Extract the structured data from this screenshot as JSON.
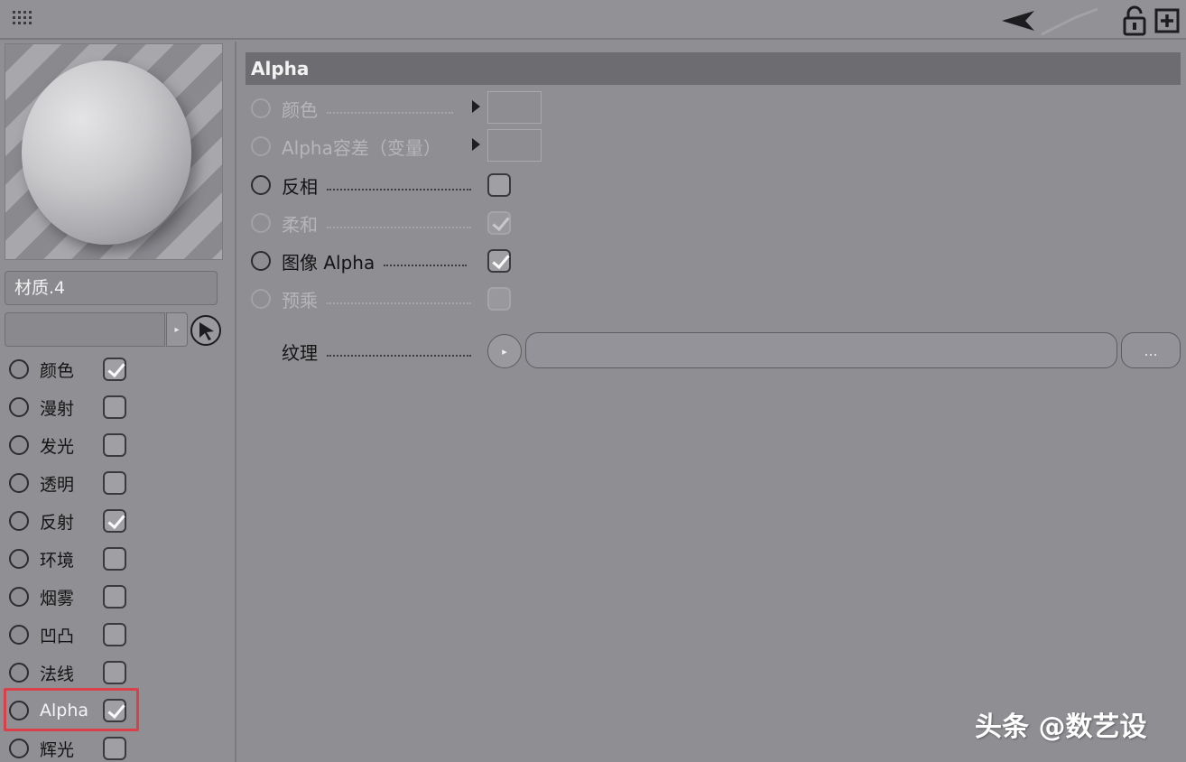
{
  "toolbar": {
    "grip_icon": "grip-icon",
    "back_icon": "back-arrow-icon",
    "lock_icon": "unlock-icon",
    "new_icon": "new-window-icon"
  },
  "left": {
    "material_name": "材质.4",
    "layer_value": "",
    "channels": [
      {
        "label": "颜色",
        "checked": true
      },
      {
        "label": "漫射",
        "checked": false
      },
      {
        "label": "发光",
        "checked": false
      },
      {
        "label": "透明",
        "checked": false
      },
      {
        "label": "反射",
        "checked": true
      },
      {
        "label": "环境",
        "checked": false
      },
      {
        "label": "烟雾",
        "checked": false
      },
      {
        "label": "凹凸",
        "checked": false
      },
      {
        "label": "法线",
        "checked": false
      },
      {
        "label": "Alpha",
        "checked": true
      },
      {
        "label": "辉光",
        "checked": false
      }
    ]
  },
  "right": {
    "title": "Alpha",
    "props": {
      "color": "颜色",
      "alpha_tolerance": "Alpha容差（变量）",
      "invert": "反相",
      "soft": "柔和",
      "image_alpha": "图像 Alpha",
      "premultiply": "预乘",
      "texture": "纹理"
    },
    "texture_more": "..."
  },
  "watermark": "头条 @数艺设",
  "colors": {
    "background": "#8f8e93",
    "header": "#6d6c71",
    "highlight": "#d9404a"
  }
}
